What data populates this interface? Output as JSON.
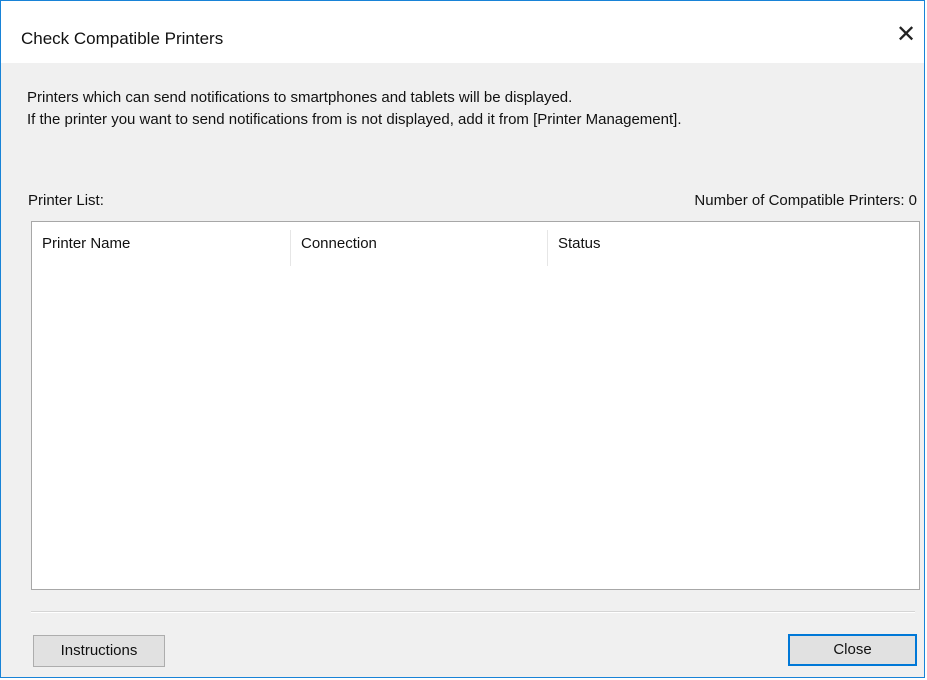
{
  "window": {
    "title": "Check Compatible Printers",
    "close_glyph": "✕"
  },
  "description": {
    "line1": "Printers which can send notifications to smartphones and tablets will be displayed.",
    "line2": "If the printer you want to send notifications from is not displayed, add it from [Printer Management]."
  },
  "printer_list": {
    "label": "Printer List:",
    "count_label": "Number of Compatible Printers: ",
    "count_value": "0",
    "columns": [
      "Printer Name",
      "Connection",
      "Status"
    ],
    "rows": []
  },
  "buttons": {
    "instructions": "Instructions",
    "close": "Close"
  },
  "colors": {
    "window_border": "#1883d7",
    "dialog_background": "#f0f0f0",
    "default_button_border": "#0078d7"
  },
  "icons": {
    "close": "close-icon"
  }
}
